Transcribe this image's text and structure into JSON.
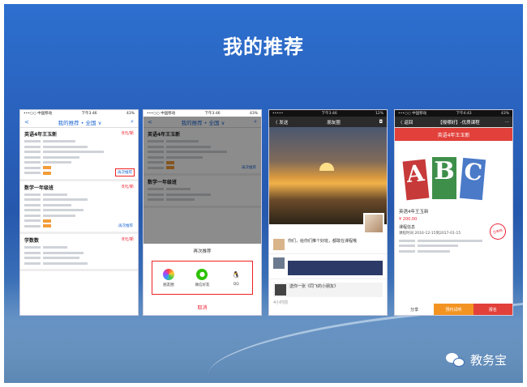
{
  "slide": {
    "title": "我的推荐",
    "brand": "教务宝"
  },
  "phone1": {
    "status_carrier": "•••○○ 中国移动",
    "status_time": "下午3:46",
    "status_battery": "43%",
    "nav_title": "我的推荐 • 全国 ∨",
    "cards": [
      {
        "title": "英语4年王玉新",
        "price": "8元/新",
        "recommend": "再次推荐"
      },
      {
        "title": "数学一年级班",
        "price": "8元/新",
        "recommend": "再次推荐"
      },
      {
        "title": "学数数",
        "price": "8元/新",
        "recommend": ""
      }
    ]
  },
  "phone2": {
    "status_carrier": "•••○○ 中国移动",
    "status_time": "下午3:46",
    "status_battery": "43%",
    "nav_title": "我的推荐 • 全国 ∨",
    "card_title": "英语4年王玉新",
    "card2_title": "数学一年级班",
    "recommend": "再次推荐",
    "sheet_title": "再次推荐",
    "options": [
      {
        "label": "朋友圈",
        "icon": "moments-icon"
      },
      {
        "label": "微信好友",
        "icon": "wechat-icon"
      },
      {
        "label": "QQ",
        "icon": "qq-icon"
      }
    ],
    "cancel": "取消"
  },
  "phone3": {
    "status_time": "下午3:46",
    "status_battery": "12%",
    "back": "〈 发送",
    "title": "朋友圈",
    "post_text": "你们，给你们推个好班，都敢在课程哦",
    "post_text2": "送你一张《同飞的小朋友》",
    "post_meta": "4小时前"
  },
  "phone4": {
    "status_carrier": "•••○○ 中国移动",
    "status_time": "下午4:43",
    "status_battery": "43%",
    "back": "〈 返回",
    "title": "【报哪好】-优质课程",
    "banner": "英语4年王玉新",
    "course_title": "英语4年王玉新",
    "price": "¥ 200.00",
    "stamp": "已审核",
    "info_title": "课程信息",
    "info_line": "课程时间  2016-12-15到2017-01-15",
    "btn_consult": "预约试听",
    "btn_buy": "报名",
    "btn_home": "分享"
  }
}
